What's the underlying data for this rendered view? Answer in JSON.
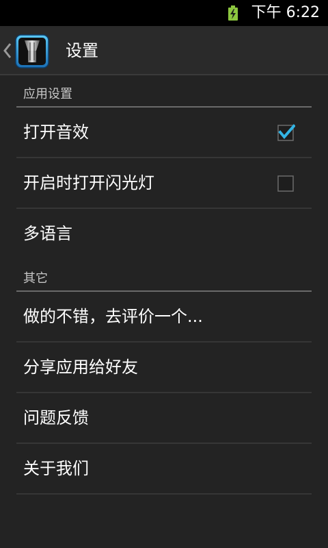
{
  "status_bar": {
    "battery_icon": "battery-charging-icon",
    "battery_color": "#8cc63f",
    "time": "下午 6:22"
  },
  "action_bar": {
    "back_icon": "chevron-left-icon",
    "app_icon": "flashlight-app-icon",
    "title": "设置"
  },
  "sections": [
    {
      "header": "应用设置",
      "items": [
        {
          "label": "打开音效",
          "checkbox": true,
          "checked": true
        },
        {
          "label": "开启时打开闪光灯",
          "checkbox": true,
          "checked": false
        },
        {
          "label": "多语言",
          "checkbox": false
        }
      ]
    },
    {
      "header": "其它",
      "items": [
        {
          "label": "做的不错，去评价一个..."
        },
        {
          "label": "分享应用给好友"
        },
        {
          "label": "问题反馈"
        },
        {
          "label": "关于我们"
        }
      ]
    }
  ],
  "colors": {
    "accent": "#33b5e5",
    "background": "#232323",
    "status_bar": "#000000"
  }
}
